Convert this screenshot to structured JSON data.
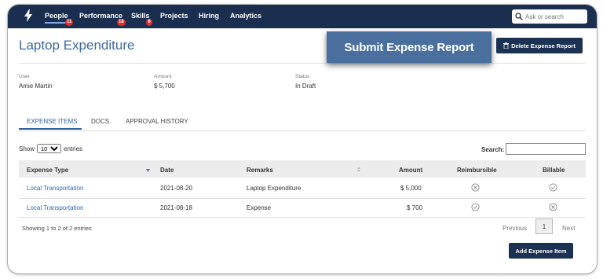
{
  "nav": {
    "items": [
      {
        "label": "People",
        "badge": "11"
      },
      {
        "label": "Performance",
        "badge": "18"
      },
      {
        "label": "Skills",
        "badge": "8"
      },
      {
        "label": "Projects",
        "badge": ""
      },
      {
        "label": "Hiring",
        "badge": ""
      },
      {
        "label": "Analytics",
        "badge": ""
      }
    ],
    "search_placeholder": "Ask or search",
    "logo_icon": "bolt-icon"
  },
  "header": {
    "title": "Laptop Expenditure",
    "submit_label": "Submit Expense Report",
    "delete_label": "Delete Expense Report"
  },
  "meta": {
    "user_label": "User",
    "user_value": "Amie Martin",
    "amount_label": "Amount",
    "amount_value": "$ 5,700",
    "status_label": "Status",
    "status_value": "In Draft"
  },
  "tabs": [
    {
      "label": "EXPENSE ITEMS",
      "active": true
    },
    {
      "label": "DOCS",
      "active": false
    },
    {
      "label": "APPROVAL HISTORY",
      "active": false
    }
  ],
  "table_controls": {
    "show_label": "Show",
    "entries_value": "10",
    "entries_label": "entries",
    "search_label": "Search:"
  },
  "table": {
    "headers": [
      "Expense Type",
      "Date",
      "Remarks",
      "Amount",
      "Reimbursible",
      "Billable"
    ],
    "rows": [
      {
        "type": "Local Transportation",
        "date": "2021-08-20",
        "remarks": "Laptop Expenditure",
        "amount": "$ 5,000",
        "reimbursible": "x-circle-icon",
        "billable": "check-circle-icon"
      },
      {
        "type": "Local Transportation",
        "date": "2021-08-18",
        "remarks": "Expense",
        "amount": "$ 700",
        "reimbursible": "check-circle-icon",
        "billable": "x-circle-icon"
      }
    ]
  },
  "footer": {
    "showing": "Showing 1 to 2 of 2 entries",
    "previous": "Previous",
    "page": "1",
    "next": "Next",
    "add_label": "Add Expense Item"
  },
  "colors": {
    "nav_bg": "#1a2e4f",
    "accent": "#3d6a9c",
    "submit_bg": "#4a6f9e",
    "dark_button": "#1c3253",
    "badge": "#e02b2b",
    "link": "#2e68b0"
  }
}
